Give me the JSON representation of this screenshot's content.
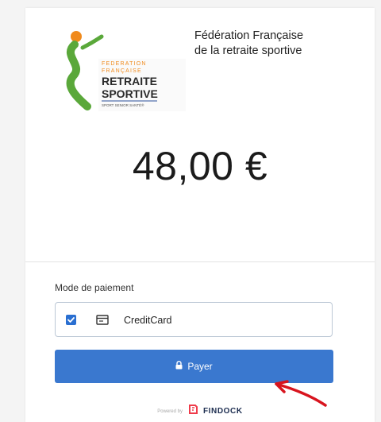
{
  "logo": {
    "line1": "FEDERATION",
    "line2": "FRANÇAISE",
    "line3": "RETRAITE",
    "line4": "SPORTIVE",
    "tagline": "SPORT SENIOR SANTÉ®"
  },
  "organization": {
    "name_line1": "Fédération Française",
    "name_line2": "de la retraite sportive"
  },
  "payment": {
    "amount": "48,00 €",
    "mode_label": "Mode de paiement",
    "method": {
      "name": "CreditCard",
      "selected": true,
      "icon": "credit-card-icon"
    },
    "pay_button": {
      "label": "Payer",
      "icon": "lock-icon"
    }
  },
  "footer": {
    "powered_by": "Powered by",
    "brand": "FINDOCK"
  },
  "colors": {
    "button": "#3a78cf",
    "checkbox": "#2a6fd1",
    "annotation_arrow": "#d8141e",
    "logo_green": "#5aa83a",
    "logo_orange": "#f08a1c",
    "logo_blue": "#2a4f9a"
  }
}
